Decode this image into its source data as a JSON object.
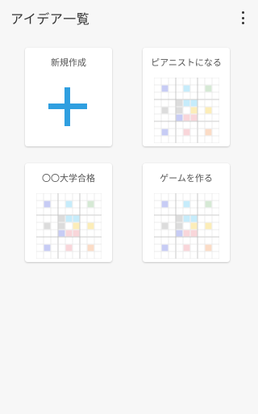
{
  "app_bar": {
    "title": "アイデア一覧",
    "menu_icon": "more-vert-icon"
  },
  "cards": [
    {
      "id": "new",
      "label": "新規作成",
      "type": "new",
      "icon": "plus-icon"
    },
    {
      "id": "pianist",
      "label": "ピアニストになる",
      "type": "mandala"
    },
    {
      "id": "university",
      "label": "〇〇大学合格",
      "type": "mandala"
    },
    {
      "id": "game",
      "label": "ゲームを作る",
      "type": "mandala"
    }
  ],
  "colors": {
    "accent_plus": "#2f9fe0",
    "grid_line": "#dddddd",
    "grid_line_strong": "#bbbbbb",
    "mandala_cells": {
      "blue": "#c7ccf5",
      "cyan": "#c6ecfb",
      "green": "#d6e9d5",
      "gray": "#dcdcdc",
      "yellow": "#fcedb8",
      "pink": "#f9d6da",
      "peach": "#fbdcc6"
    }
  }
}
